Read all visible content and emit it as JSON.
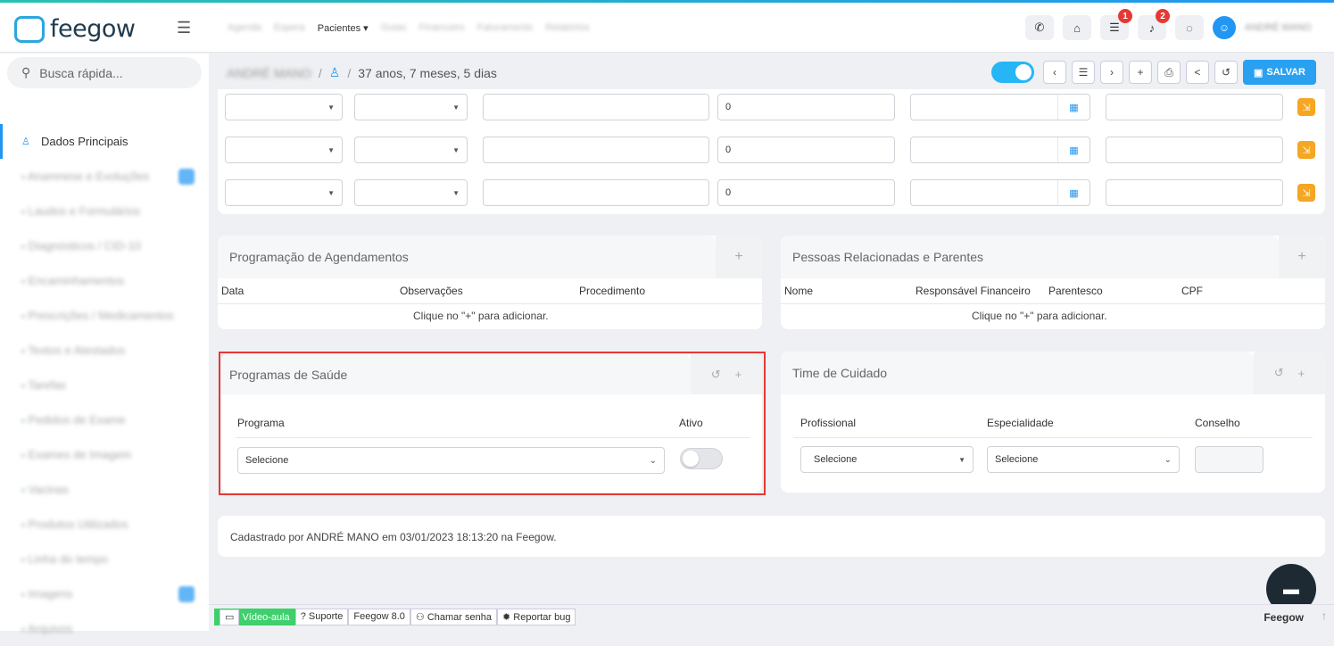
{
  "app": {
    "name": "feegow"
  },
  "nav": {
    "items": [
      "Agenda",
      "Espera",
      "Pacientes",
      "Guias",
      "Financeiro",
      "Faturamento",
      "Relatórios"
    ],
    "active": "Pacientes"
  },
  "header": {
    "badges": {
      "tasks": "1",
      "notifications": "2"
    },
    "user": "ANDRÉ MANO"
  },
  "search": {
    "placeholder": "Busca rápida..."
  },
  "sidebar": {
    "items": [
      {
        "label": "Dados Principais"
      },
      {
        "label": "Anamnese e Evoluções"
      },
      {
        "label": "Laudos e Formulários"
      },
      {
        "label": "Diagnósticos / CID-10"
      },
      {
        "label": "Encaminhamentos"
      },
      {
        "label": "Prescrições / Medicamentos"
      },
      {
        "label": "Textos e Atestados"
      },
      {
        "label": "Tarefas"
      },
      {
        "label": "Pedidos de Exame"
      },
      {
        "label": "Exames de Imagem"
      },
      {
        "label": "Vacinas"
      },
      {
        "label": "Produtos Utilizados"
      },
      {
        "label": "Linha do tempo"
      },
      {
        "label": "Imagens"
      },
      {
        "label": "Arquivos"
      }
    ]
  },
  "patient": {
    "name": "ANDRÉ MANO",
    "age": "37 anos, 7 meses, 5 dias"
  },
  "toolbar": {
    "save_label": "SALVAR"
  },
  "form_rows": [
    {
      "value": "0"
    },
    {
      "value": "0"
    },
    {
      "value": "0"
    }
  ],
  "agendamentos": {
    "title": "Programação de Agendamentos",
    "cols": [
      "Data",
      "Observações",
      "Procedimento"
    ],
    "empty": "Clique no  \"+\" para adicionar."
  },
  "pessoas": {
    "title": "Pessoas Relacionadas e Parentes",
    "cols": [
      "Nome",
      "Responsável Financeiro",
      "Parentesco",
      "CPF"
    ],
    "empty": "Clique no  \"+\" para adicionar."
  },
  "programas": {
    "title": "Programas de Saúde",
    "col_programa": "Programa",
    "col_ativo": "Ativo",
    "select_value": "Selecione"
  },
  "time": {
    "title": "Time de Cuidado",
    "cols": [
      "Profissional",
      "Especialidade",
      "Conselho"
    ],
    "select1": "Selecione",
    "select2": "Selecione"
  },
  "cadastro": {
    "text": "Cadastrado por ANDRÉ MANO em 03/01/2023 18:13:20 na Feegow."
  },
  "footer": {
    "video": "Vídeo-aula",
    "suporte": "Suporte",
    "version": "Feegow 8.0",
    "chamar": "Chamar senha",
    "bug": "Reportar bug",
    "brand": "Feegow"
  },
  "colors": {
    "accent": "#2196f3",
    "save": "#2aa0f0",
    "warning": "#f5a623",
    "highlight": "#e53935"
  }
}
